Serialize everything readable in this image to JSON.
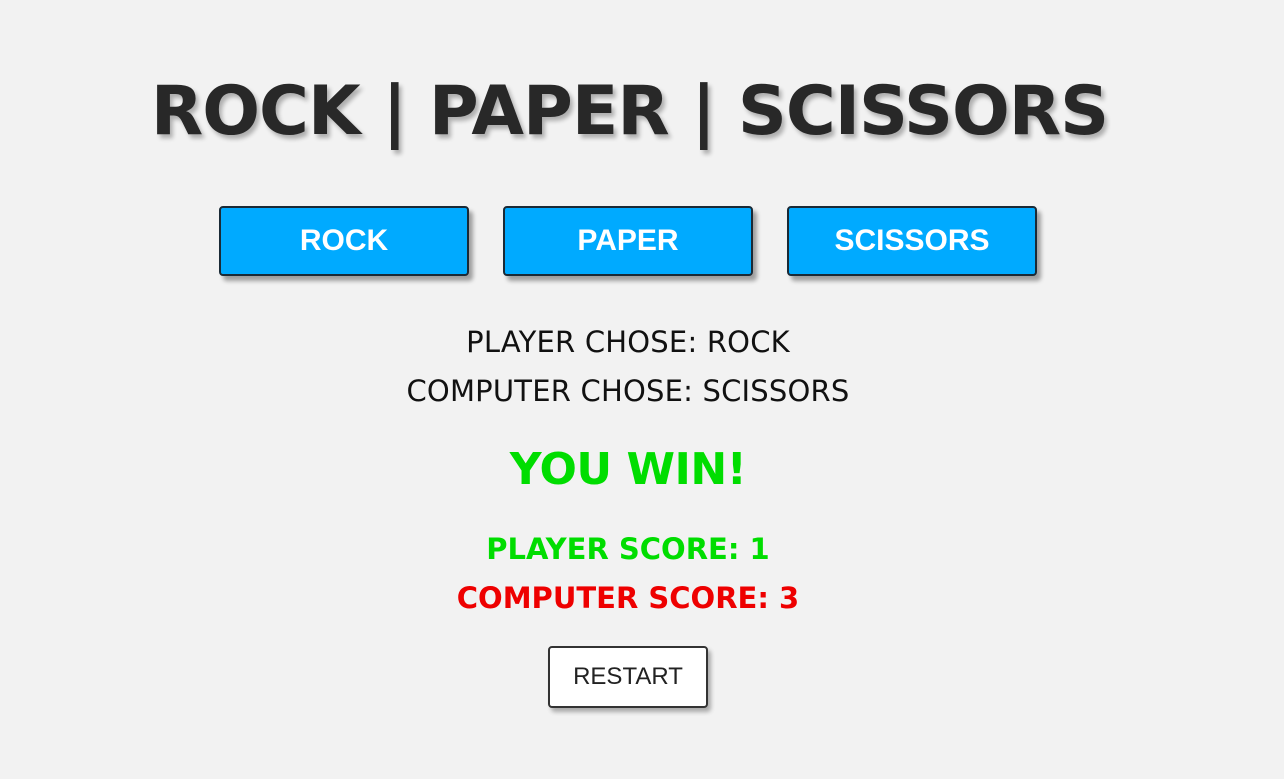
{
  "title": "ROCK | PAPER | SCISSORS",
  "choices": {
    "rock_label": "ROCK",
    "paper_label": "PAPER",
    "scissors_label": "SCISSORS"
  },
  "round": {
    "player_chose": "PLAYER CHOSE: ROCK",
    "computer_chose": "COMPUTER CHOSE: SCISSORS",
    "result": "YOU WIN!"
  },
  "scores": {
    "player": "PLAYER SCORE: 1",
    "computer": "COMPUTER SCORE: 3"
  },
  "restart_label": "RESTART",
  "colors": {
    "background": "#f2f2f2",
    "title": "#282828",
    "choice_button": "#00aaff",
    "win": "#00dd00",
    "lose": "#ee0000"
  }
}
